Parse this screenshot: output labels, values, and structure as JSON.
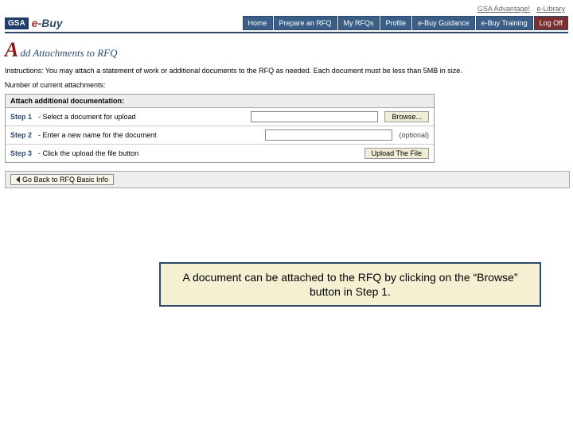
{
  "toplinks": {
    "left": "GSA Advantage!",
    "right": "e-Library"
  },
  "logo": {
    "gsa": "GSA",
    "ebuy_e": "e",
    "ebuy_rest": "-Buy"
  },
  "nav": {
    "home": "Home",
    "prepare": "Prepare an RFQ",
    "myrfqs": "My RFQs",
    "profile": "Profile",
    "guidance": "e-Buy Guidance",
    "training": "e-Buy Training",
    "logoff": "Log Off"
  },
  "page_title": {
    "big": "A",
    "rest": "dd Attachments to RFQ"
  },
  "instructions": "Instructions: You may attach a statement of work or additional documents to the RFQ as needed. Each document must be less than 5MB in size.",
  "note": "Number of current attachments:",
  "attach": {
    "header": "Attach additional documentation:",
    "step1_label": "Step 1",
    "step1_text": "- Select a document for upload",
    "browse": "Browse...",
    "step2_label": "Step 2",
    "step2_text": "- Enter a new name for the document",
    "optional": "(optional)",
    "step3_label": "Step 3",
    "step3_text": "- Click the upload the file button",
    "upload": "Upload The File"
  },
  "goback": "Go Back to RFQ Basic Info",
  "callout": "A document can be attached to the RFQ by clicking on the “Browse” button in Step 1."
}
